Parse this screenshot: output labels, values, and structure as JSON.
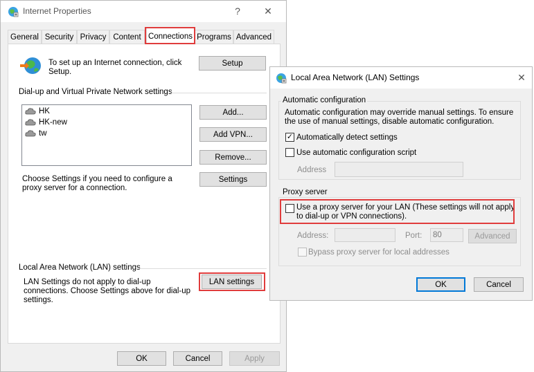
{
  "internet_properties": {
    "title": "Internet Properties",
    "controls": {
      "help": "?",
      "close": "✕"
    },
    "tabs": [
      {
        "label": "General"
      },
      {
        "label": "Security"
      },
      {
        "label": "Privacy"
      },
      {
        "label": "Content"
      },
      {
        "label": "Connections"
      },
      {
        "label": "Programs"
      },
      {
        "label": "Advanced"
      }
    ],
    "active_tab": "Connections",
    "setup": {
      "text": "To set up an Internet connection, click Setup.",
      "button": "Setup"
    },
    "dialup": {
      "heading": "Dial-up and Virtual Private Network settings",
      "items": [
        "HK",
        "HK-new",
        "tw"
      ],
      "buttons": {
        "add": "Add...",
        "add_vpn": "Add VPN...",
        "remove": "Remove..."
      },
      "proxy_text": "Choose Settings if you need to configure a proxy server for a connection.",
      "settings_button": "Settings"
    },
    "lan": {
      "heading": "Local Area Network (LAN) settings",
      "text": "LAN Settings do not apply to dial-up connections. Choose Settings above for dial-up settings.",
      "button": "LAN settings"
    },
    "footer": {
      "ok": "OK",
      "cancel": "Cancel",
      "apply": "Apply"
    }
  },
  "lan_settings": {
    "title": "Local Area Network (LAN) Settings",
    "controls": {
      "close": "✕"
    },
    "auto_config": {
      "heading": "Automatic configuration",
      "description": "Automatic configuration may override manual settings.  To ensure the use of manual settings, disable automatic configuration.",
      "auto_detect": {
        "label": "Automatically detect settings",
        "checked": true
      },
      "auto_script": {
        "label": "Use automatic configuration script",
        "checked": false
      },
      "address_label": "Address",
      "address_value": ""
    },
    "proxy": {
      "heading": "Proxy server",
      "use_proxy": {
        "label": "Use a proxy server for your LAN (These settings will not apply to dial-up or VPN connections).",
        "checked": false
      },
      "address_label": "Address:",
      "address_value": "",
      "port_label": "Port:",
      "port_value": "80",
      "advanced_button": "Advanced",
      "bypass": {
        "label": "Bypass proxy server for local addresses",
        "checked": false
      }
    },
    "footer": {
      "ok": "OK",
      "cancel": "Cancel"
    }
  },
  "colors": {
    "highlight_border": "#e03c3c",
    "default_button_border": "#0078d7",
    "dialog_background": "#f0f0f0"
  }
}
